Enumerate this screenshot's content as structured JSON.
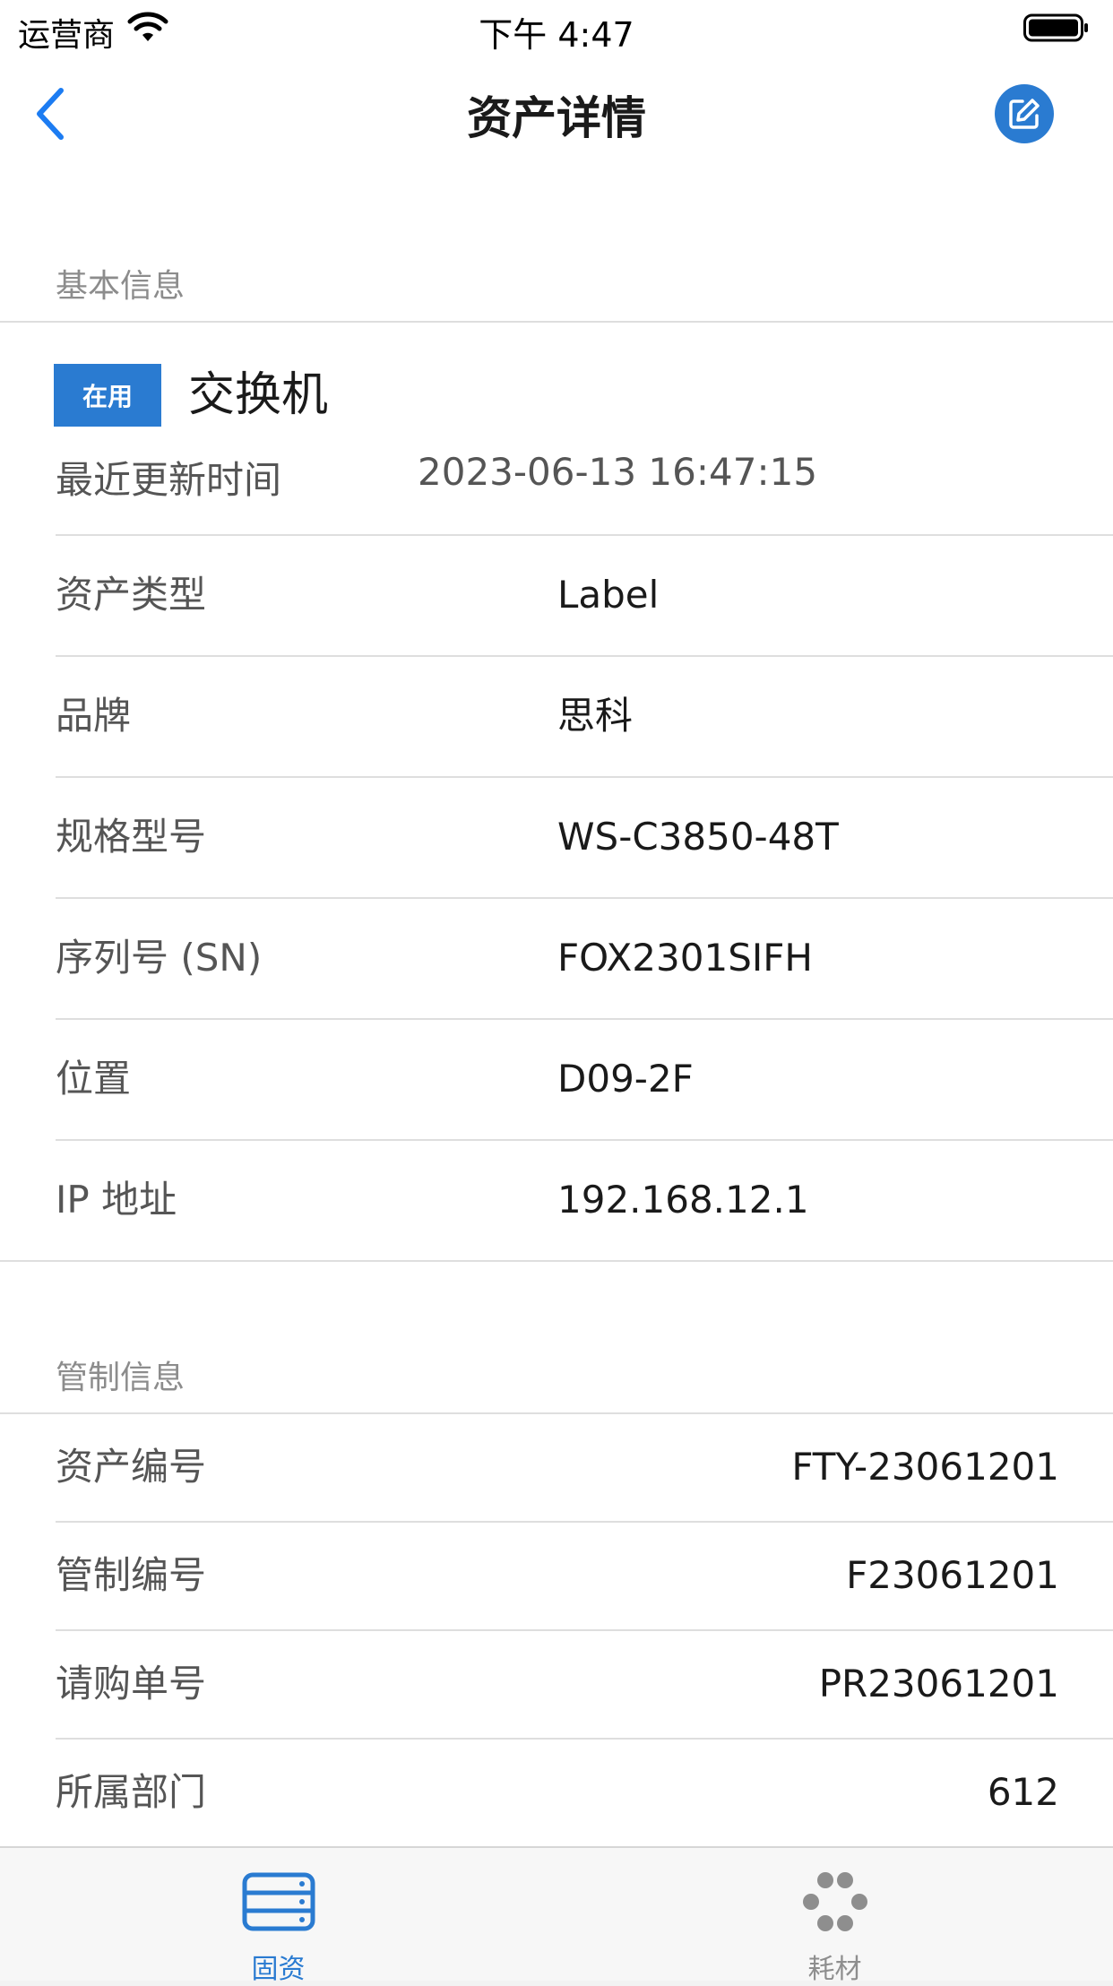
{
  "status_bar": {
    "carrier": "运营商",
    "time": "下午 4:47"
  },
  "nav": {
    "title": "资产详情"
  },
  "basic_info": {
    "section_title": "基本信息",
    "status_badge": "在用",
    "asset_name": "交换机",
    "updated_label": "最近更新时间",
    "updated_value": "2023-06-13 16:47:15",
    "rows": [
      {
        "label": "资产类型",
        "value": "Label"
      },
      {
        "label": "品牌",
        "value": "思科"
      },
      {
        "label": "规格型号",
        "value": "WS-C3850-48T"
      },
      {
        "label": "序列号 (SN)",
        "value": "FOX2301SIFH"
      },
      {
        "label": "位置",
        "value": "D09-2F"
      },
      {
        "label": "IP 地址",
        "value": "192.168.12.1"
      }
    ]
  },
  "control_info": {
    "section_title": "管制信息",
    "rows": [
      {
        "label": "资产编号",
        "value": "FTY-23061201"
      },
      {
        "label": "管制编号",
        "value": "F23061201"
      },
      {
        "label": "请购单号",
        "value": "PR23061201"
      },
      {
        "label": "所属部门",
        "value": "612"
      }
    ]
  },
  "tabs": [
    {
      "label": "固资",
      "icon": "server-icon",
      "active": true
    },
    {
      "label": "耗材",
      "icon": "dots-icon",
      "active": false
    }
  ],
  "colors": {
    "accent": "#2a7bd1",
    "tab_active": "#2a7bd1",
    "tab_inactive": "#8e8e8e"
  }
}
